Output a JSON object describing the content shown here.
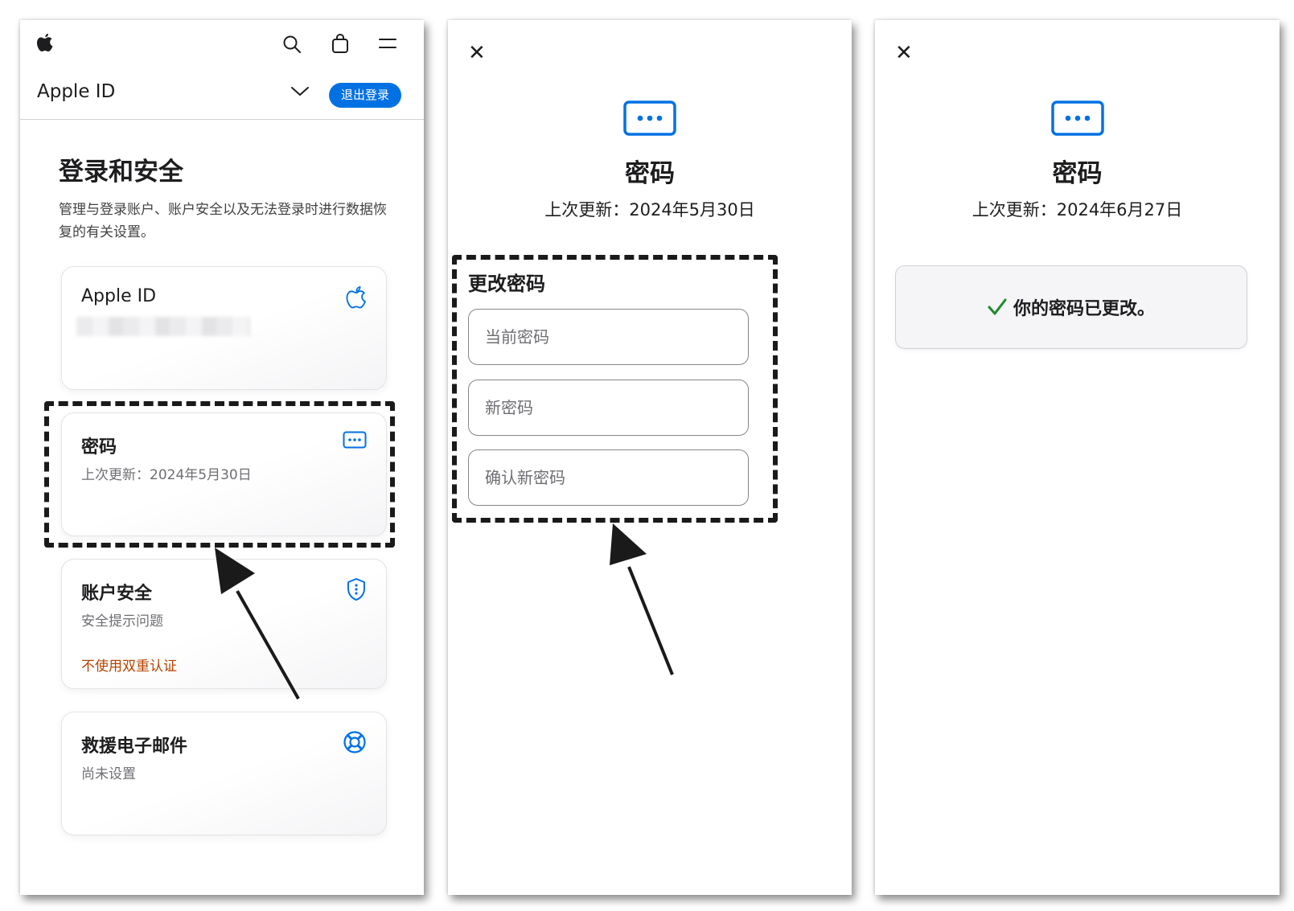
{
  "panel1": {
    "nav": {
      "icons": [
        "apple-logo-icon",
        "search-icon",
        "bag-icon",
        "menu-icon"
      ]
    },
    "subnav": {
      "title": "Apple ID",
      "signout_label": "退出登录"
    },
    "section": {
      "title": "登录和安全",
      "description": "管理与登录账户、账户安全以及无法登录时进行数据恢复的有关设置。"
    },
    "cards": {
      "apple_id": {
        "title": "Apple ID",
        "icon": "apple-logo-icon"
      },
      "password": {
        "title": "密码",
        "subtitle": "上次更新：2024年5月30日",
        "icon": "password-dots-icon"
      },
      "security": {
        "title": "账户安全",
        "subtitle": "安全提示问题",
        "warning": "不使用双重认证",
        "icon": "shield-icon"
      },
      "rescue": {
        "title": "救援电子邮件",
        "subtitle": "尚未设置",
        "icon": "lifebuoy-icon"
      }
    }
  },
  "panel2": {
    "title": "密码",
    "updated": "上次更新：2024年5月30日",
    "form": {
      "heading": "更改密码",
      "current_placeholder": "当前密码",
      "new_placeholder": "新密码",
      "confirm_placeholder": "确认新密码"
    }
  },
  "panel3": {
    "title": "密码",
    "updated": "上次更新：2024年6月27日",
    "success_message": "你的密码已更改。"
  },
  "colors": {
    "accent": "#0071e3",
    "warning": "#b64400",
    "success": "#1d8a2e",
    "annotation": "#1a1a1a"
  }
}
